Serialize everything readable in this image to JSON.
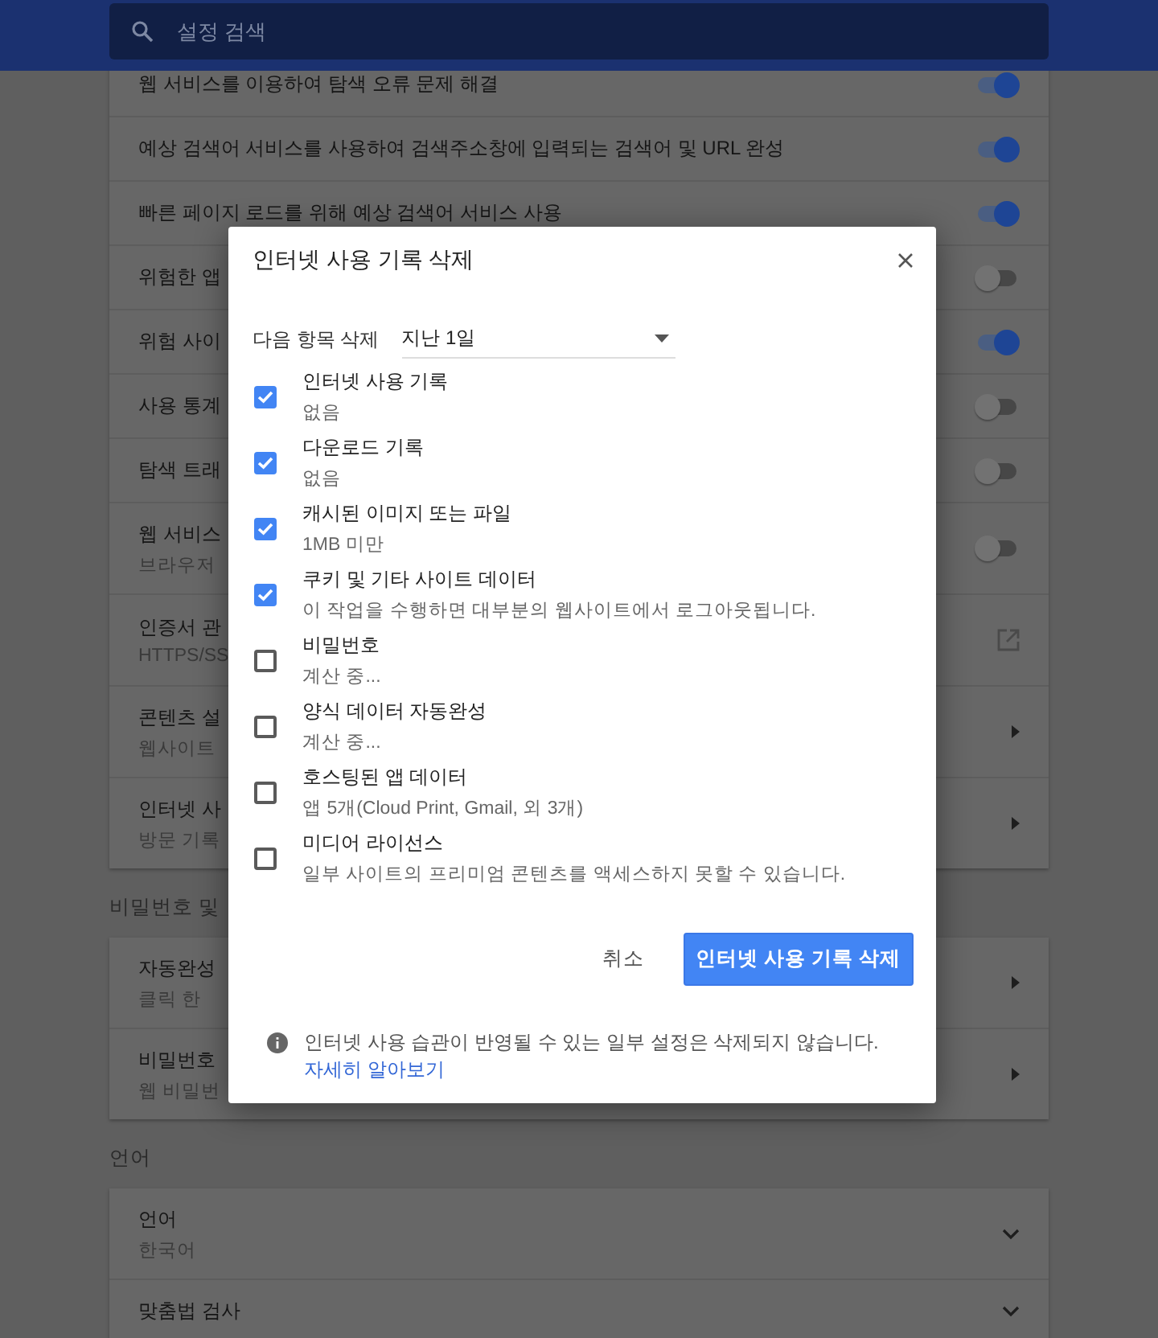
{
  "header": {
    "search": {
      "placeholder": "설정 검색"
    }
  },
  "cards": [
    {
      "rows": [
        {
          "label": "웹 서비스를 이용하여 탐색 오류 문제 해결",
          "kind": "toggle",
          "on": true
        },
        {
          "label": "예상 검색어 서비스를 사용하여 검색주소창에 입력되는 검색어 및 URL 완성",
          "kind": "toggle",
          "on": true
        },
        {
          "label": "빠른 페이지 로드를 위해 예상 검색어 서비스 사용",
          "kind": "toggle",
          "on": true
        },
        {
          "label": "위험한 앱",
          "kind": "toggle",
          "on": false
        },
        {
          "label": "위험 사이",
          "kind": "toggle",
          "on": true
        },
        {
          "label": "사용 통계",
          "kind": "toggle",
          "on": false
        },
        {
          "label": "탐색 트래",
          "kind": "toggle",
          "on": false
        },
        {
          "label": "웹 서비스",
          "sublabel": "브라우저",
          "kind": "toggle",
          "on": false
        },
        {
          "label": "인증서 관",
          "sublabel": "HTTPS/SS",
          "kind": "external"
        },
        {
          "label": "콘텐츠 설",
          "sublabel": "웹사이트",
          "kind": "arrow"
        },
        {
          "label": "인터넷 사",
          "sublabel": "방문 기록",
          "kind": "arrow"
        }
      ]
    },
    {
      "title": "비밀번호 및",
      "rows": [
        {
          "label": "자동완성",
          "sublabel": "클릭 한",
          "kind": "arrow"
        },
        {
          "label": "비밀번호",
          "sublabel": "웹 비밀번",
          "kind": "arrow"
        }
      ]
    },
    {
      "title": "언어",
      "rows": [
        {
          "label": "언어",
          "sublabel": "한국어",
          "kind": "expand"
        },
        {
          "label": "맞춤법 검사",
          "kind": "expand"
        }
      ]
    }
  ],
  "dialog": {
    "title": "인터넷 사용 기록 삭제",
    "range": {
      "label": "다음 항목 삭제",
      "value": "지난 1일"
    },
    "items": [
      {
        "label": "인터넷 사용 기록",
        "detail": "없음",
        "checked": true
      },
      {
        "label": "다운로드 기록",
        "detail": "없음",
        "checked": true
      },
      {
        "label": "캐시된 이미지 또는 파일",
        "detail": "1MB 미만",
        "checked": true
      },
      {
        "label": "쿠키 및 기타 사이트 데이터",
        "detail": "이 작업을 수행하면 대부분의 웹사이트에서 로그아웃됩니다.",
        "checked": true
      },
      {
        "label": "비밀번호",
        "detail": "계산 중...",
        "checked": false
      },
      {
        "label": "양식 데이터 자동완성",
        "detail": "계산 중...",
        "checked": false
      },
      {
        "label": "호스팅된 앱 데이터",
        "detail": "앱 5개(Cloud Print, Gmail, 외 3개)",
        "checked": false
      },
      {
        "label": "미디어 라이선스",
        "detail": "일부 사이트의 프리미엄 콘텐츠를 액세스하지 못할 수 있습니다.",
        "checked": false
      }
    ],
    "buttons": [
      {
        "label": "취소",
        "kind": "text"
      },
      {
        "label": "인터넷 사용 기록 삭제",
        "kind": "primary"
      }
    ],
    "footer": {
      "text": "인터넷 사용 습관이 반영될 수 있는 일부 설정은 삭제되지 않습니다.",
      "link": "자세히 알아보기"
    }
  }
}
